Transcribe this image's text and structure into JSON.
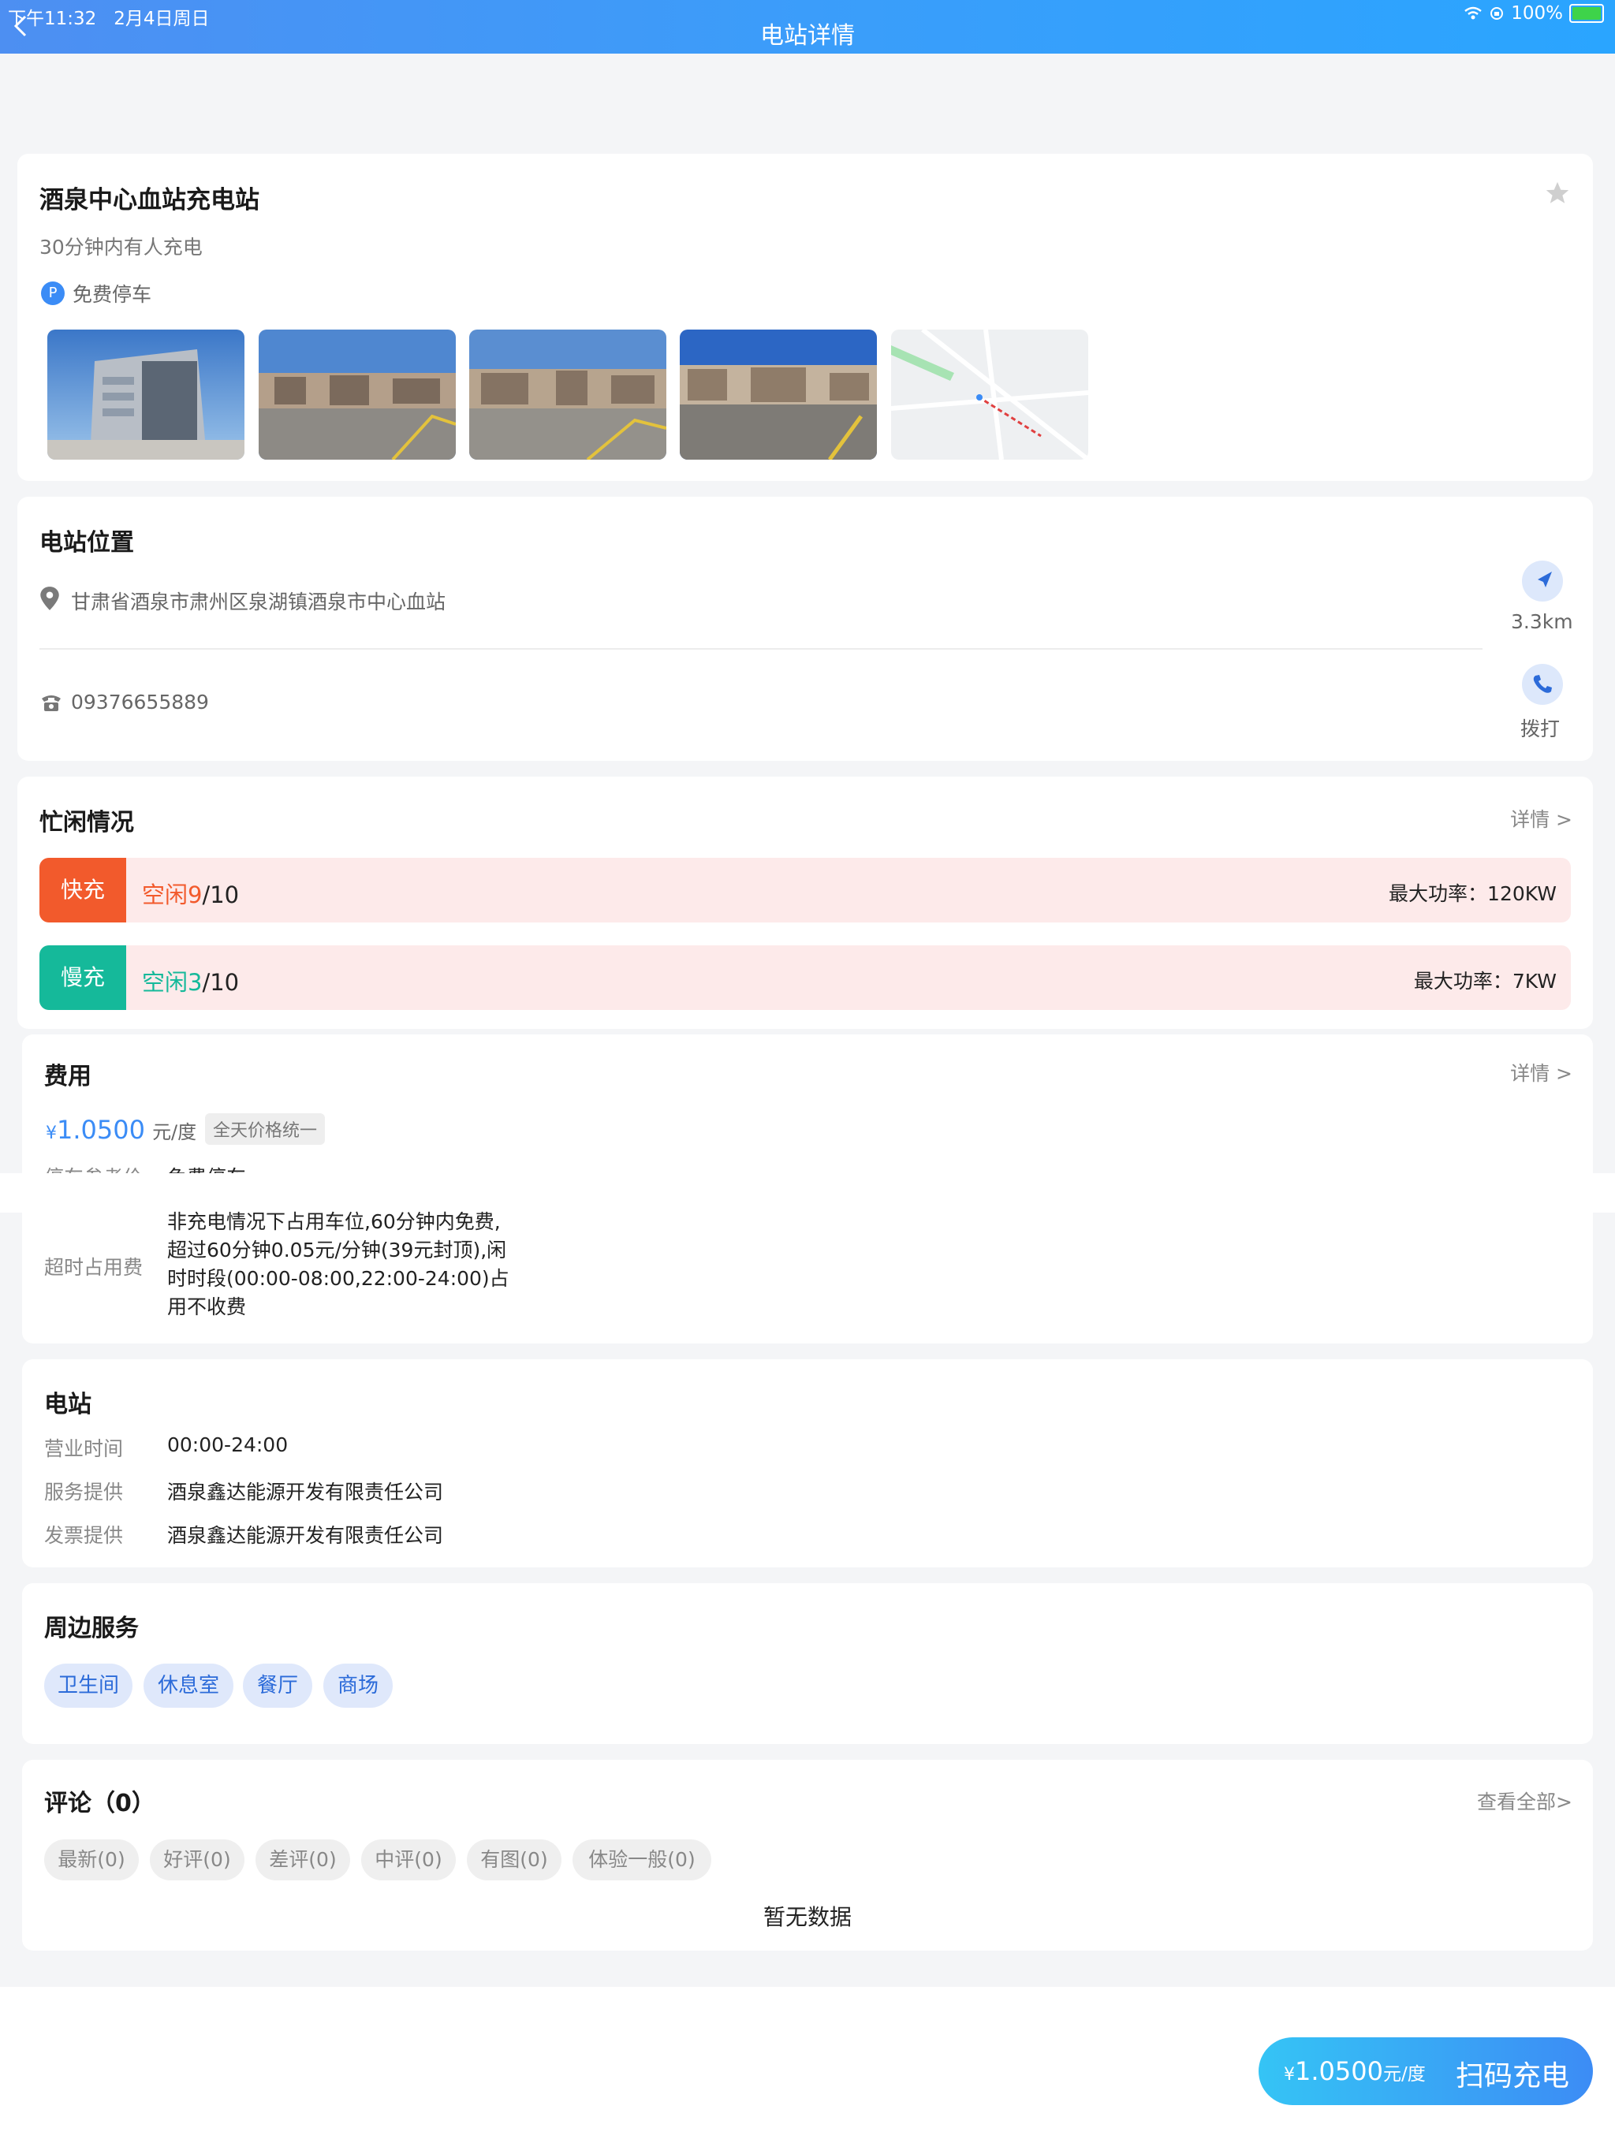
{
  "status_bar": {
    "time": "下午11:32",
    "date": "2月4日周日",
    "battery": "100%",
    "title": "电站详情"
  },
  "station": {
    "name": "酒泉中心血站充电站",
    "subtitle": "30分钟内有人充电",
    "parking_badge": "P",
    "parking": "免费停车"
  },
  "location": {
    "heading": "电站位置",
    "address": "甘肃省酒泉市肃州区泉湖镇酒泉市中心血站",
    "distance": "3.3km",
    "phone": "09376655889",
    "call_label": "拨打"
  },
  "busy": {
    "heading": "忙闲情况",
    "detail_link": "详情 >",
    "fast": {
      "tag": "快充",
      "free_label": "空闲9",
      "total": "/10",
      "power": "最大功率：120KW"
    },
    "slow": {
      "tag": "慢充",
      "free_label": "空闲3",
      "total": "/10",
      "power": "最大功率：7KW"
    }
  },
  "fee": {
    "heading": "费用",
    "detail_link": "详情 >",
    "currency": "¥",
    "price": "1.0500",
    "unit": "元/度",
    "badge": "全天价格统一",
    "parking_label": "停车参考价",
    "parking_value": "免费停车",
    "overtime_label": "超时占用费",
    "overtime_lines": [
      "非充电情况下占用车位,60分钟内免费,",
      "超过60分钟0.05元/分钟(39元封顶),闲",
      "时时段(00:00-08:00,22:00-24:00)占",
      "用不收费"
    ]
  },
  "info": {
    "heading": "电站",
    "rows": [
      {
        "label": "营业时间",
        "value": "00:00-24:00"
      },
      {
        "label": "服务提供",
        "value": "酒泉鑫达能源开发有限责任公司"
      },
      {
        "label": "发票提供",
        "value": "酒泉鑫达能源开发有限责任公司"
      }
    ]
  },
  "services": {
    "heading": "周边服务",
    "items": [
      "卫生间",
      "休息室",
      "餐厅",
      "商场"
    ]
  },
  "reviews": {
    "heading": "评论（0）",
    "view_all": "查看全部>",
    "tabs": [
      "最新(0)",
      "好评(0)",
      "差评(0)",
      "中评(0)",
      "有图(0)",
      "体验一般(0)"
    ],
    "empty": "暂无数据"
  },
  "footer": {
    "currency": "¥",
    "price": "1.0500",
    "unit": "元/度",
    "action": "扫码充电"
  },
  "colors": {
    "accent": "#3b8cf6",
    "fast": "#f25a2c",
    "slow": "#15b99a"
  }
}
